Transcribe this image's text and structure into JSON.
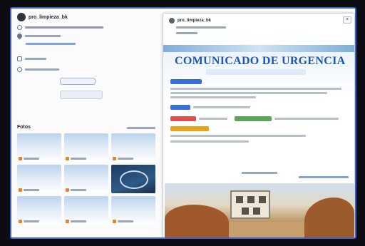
{
  "colors": {
    "accent": "#3b6fd8",
    "headline": "#1b57b8",
    "tag_blue": "#3b6fd8",
    "tag_red": "#e05050",
    "tag_green": "#5aa55a",
    "tag_orange": "#e6a21a"
  },
  "left_panel": {
    "username": "pro_limpieza_bk",
    "photos_label": "Fotos"
  },
  "right_panel": {
    "username": "pro_limpieza_bk",
    "headline": "COMUNICADO DE URGENCIA"
  },
  "icons": {
    "close": "close-icon",
    "location": "location-icon",
    "link": "link-icon",
    "avatar": "avatar-icon"
  }
}
